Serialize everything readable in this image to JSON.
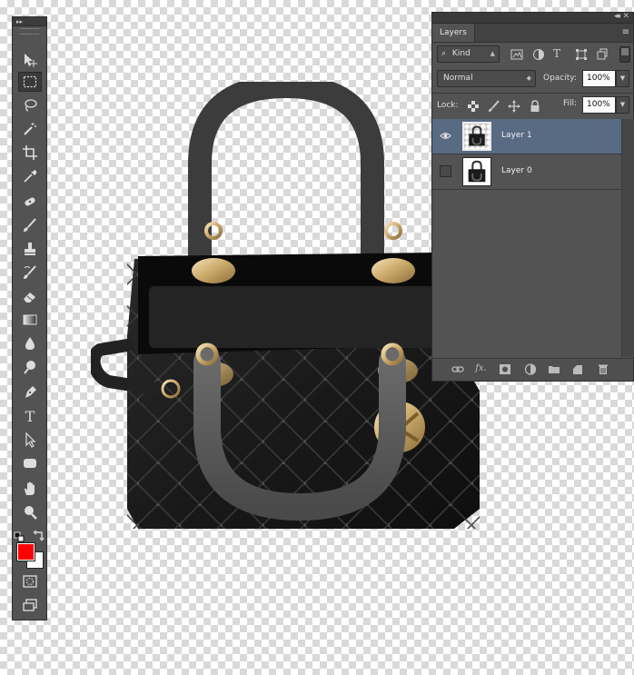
{
  "toolbar": {
    "collapse_label": "▸▸",
    "tools": [
      {
        "name": "move-tool",
        "icon": "move-icon",
        "active": false
      },
      {
        "name": "marquee-tool",
        "icon": "rect-marquee-icon",
        "active": true
      },
      {
        "name": "lasso-tool",
        "icon": "lasso-icon",
        "active": false
      },
      {
        "name": "quick-select-tool",
        "icon": "magic-wand-icon",
        "active": false
      },
      {
        "name": "crop-tool",
        "icon": "crop-icon",
        "active": false
      },
      {
        "name": "eyedropper-tool",
        "icon": "eyedropper-icon",
        "active": false
      },
      {
        "name": "healing-brush-tool",
        "icon": "healing-icon",
        "active": false
      },
      {
        "name": "brush-tool",
        "icon": "brush-icon",
        "active": false
      },
      {
        "name": "clone-stamp-tool",
        "icon": "stamp-icon",
        "active": false
      },
      {
        "name": "history-brush-tool",
        "icon": "history-brush-icon",
        "active": false
      },
      {
        "name": "eraser-tool",
        "icon": "eraser-icon",
        "active": false
      },
      {
        "name": "gradient-tool",
        "icon": "gradient-icon",
        "active": false
      },
      {
        "name": "blur-tool",
        "icon": "blur-drop-icon",
        "active": false
      },
      {
        "name": "dodge-tool",
        "icon": "dodge-icon",
        "active": false
      },
      {
        "name": "pen-tool",
        "icon": "pen-icon",
        "active": false
      },
      {
        "name": "type-tool",
        "icon": "type-icon",
        "active": false
      },
      {
        "name": "path-select-tool",
        "icon": "arrow-icon",
        "active": false
      },
      {
        "name": "shape-tool",
        "icon": "rounded-rect-icon",
        "active": false
      },
      {
        "name": "hand-tool",
        "icon": "hand-icon",
        "active": false
      },
      {
        "name": "zoom-tool",
        "icon": "zoom-icon",
        "active": false
      }
    ],
    "type_glyph": "T",
    "foreground_color": "#ff0000",
    "background_color": "#ffffff"
  },
  "layers_panel": {
    "collapse_glyph": "◂◂",
    "close_glyph": "✕",
    "tab_label": "Layers",
    "menu_glyph": "≡",
    "filter": {
      "label": "Kind",
      "search_glyph": "⌕"
    },
    "blend_mode": "Normal",
    "opacity_label": "Opacity:",
    "opacity_value": "100%",
    "lock_label": "Lock:",
    "fill_label": "Fill:",
    "fill_value": "100%",
    "layers": [
      {
        "name": "Layer 1",
        "visible": true,
        "selected": true
      },
      {
        "name": "Layer 0",
        "visible": false,
        "selected": false
      }
    ],
    "bottom_fx_label": "fx."
  },
  "colors": {
    "panel_bg": "#535353",
    "selected_layer": "#596a83",
    "foreground": "#ff0000"
  }
}
